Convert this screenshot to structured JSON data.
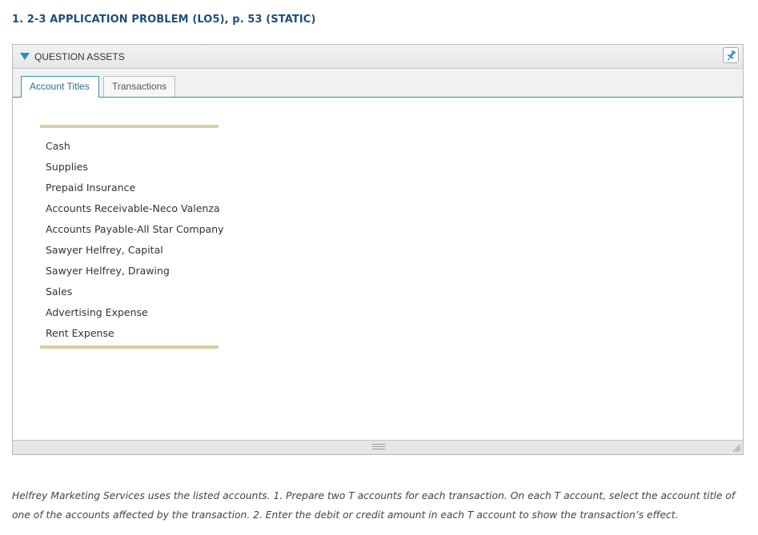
{
  "problem": {
    "title": "1. 2-3 APPLICATION PROBLEM (LO5), p. 53 (STATIC)"
  },
  "assets_panel": {
    "header_label": "QUESTION ASSETS",
    "toggle_icon": "triangle-down-icon",
    "pin_icon": "pushpin-icon",
    "accent_color": "#2b8fc6",
    "tabs": [
      {
        "label": "Account Titles",
        "active": true
      },
      {
        "label": "Transactions",
        "active": false
      }
    ],
    "accounts": [
      "Cash",
      "Supplies",
      "Prepaid Insurance",
      "Accounts Receivable-Neco Valenza",
      "Accounts Payable-All Star Company",
      "Sawyer Helfrey, Capital",
      "Sawyer Helfrey, Drawing",
      "Sales",
      "Advertising Expense",
      "Rent Expense"
    ]
  },
  "instructions": {
    "text": "Helfrey Marketing Services uses the listed accounts. 1. Prepare two T accounts for each transaction. On each T account, select the account title of one of the accounts affected by the transaction. 2. Enter the debit or credit amount in each T account to show the transaction’s effect."
  }
}
